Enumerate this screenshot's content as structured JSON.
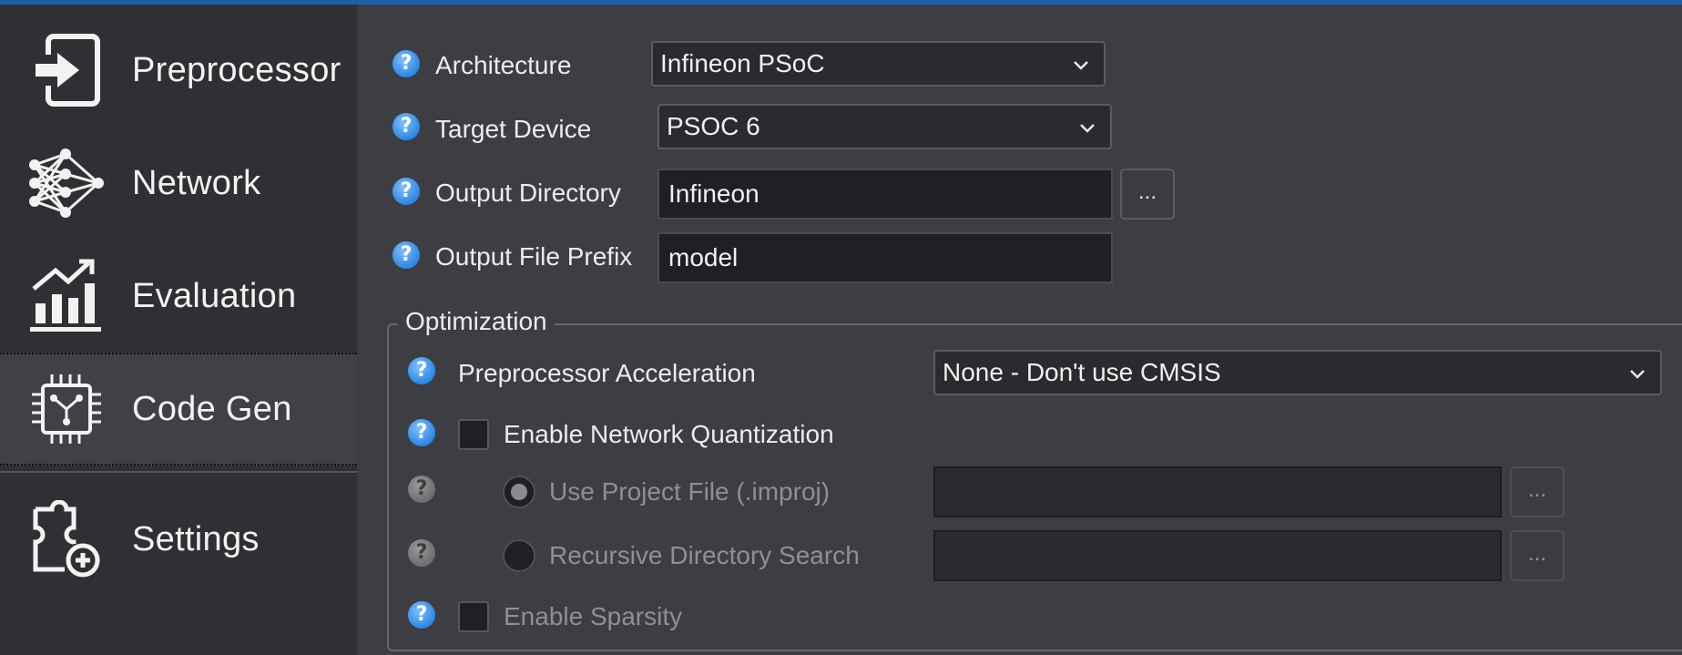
{
  "sidebar": {
    "items": [
      {
        "label": "Preprocessor",
        "icon": "sign-in-icon"
      },
      {
        "label": "Network",
        "icon": "neural-network-icon"
      },
      {
        "label": "Evaluation",
        "icon": "growth-chart-icon"
      },
      {
        "label": "Code Gen",
        "icon": "chip-icon",
        "active": true
      },
      {
        "label": "Settings",
        "icon": "puzzle-add-icon"
      }
    ]
  },
  "form": {
    "help_glyph": "?",
    "architecture": {
      "label": "Architecture",
      "value": "Infineon PSoC"
    },
    "target_device": {
      "label": "Target Device",
      "value": "PSOC 6"
    },
    "output_directory": {
      "label": "Output Directory",
      "value": "Infineon",
      "browse": "..."
    },
    "output_prefix": {
      "label": "Output File Prefix",
      "value": "model"
    }
  },
  "optimization": {
    "title": "Optimization",
    "preprocessor_acceleration": {
      "label": "Preprocessor Acceleration",
      "value": "None - Don't use CMSIS"
    },
    "enable_quantization": {
      "label": "Enable Network Quantization",
      "checked": false
    },
    "use_project_file": {
      "label": "Use Project File (.improj)",
      "value": "",
      "browse": "...",
      "selected": true,
      "enabled": false
    },
    "recursive_search": {
      "label": "Recursive Directory Search",
      "value": "",
      "browse": "...",
      "selected": false,
      "enabled": false
    },
    "enable_sparsity": {
      "label": "Enable Sparsity",
      "checked": false,
      "enabled": false
    }
  },
  "colors": {
    "accent": "#2f86e0",
    "topline": "#1f5fa8",
    "sidebar_bg": "#2f3034",
    "main_bg": "#3c3e44"
  }
}
